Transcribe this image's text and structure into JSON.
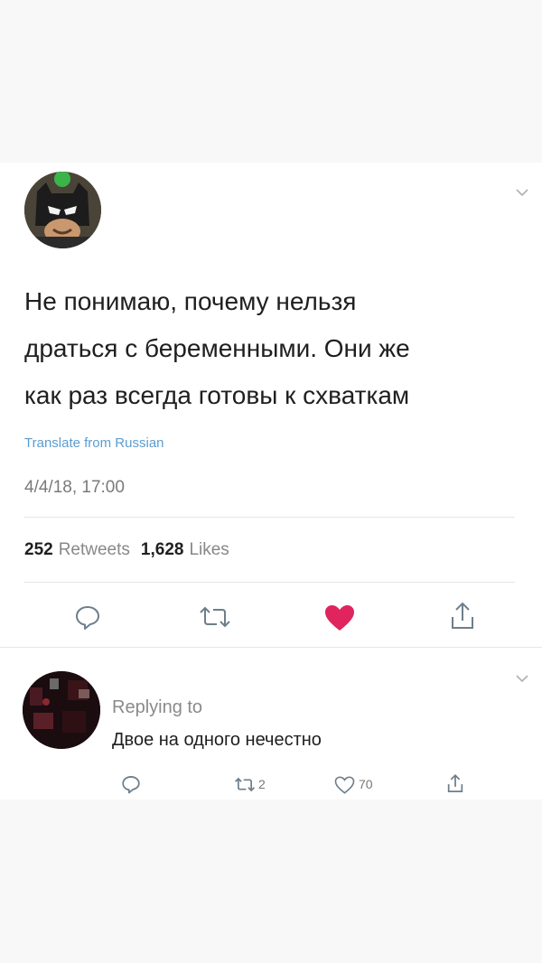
{
  "tweet": {
    "text": "Не понимаю, почему нельзя\nдраться с беременными. Они же\nкак раз всегда готовы к схваткам",
    "translate_label": "Translate from Russian",
    "timestamp": "4/4/18, 17:00",
    "retweets_count": "252",
    "retweets_label": "Retweets",
    "likes_count": "1,628",
    "likes_label": "Likes",
    "liked": true
  },
  "reply": {
    "replying_label": "Replying to",
    "text": "Двое на одного нечестно",
    "retweets_count": "2",
    "likes_count": "70"
  },
  "icons": {
    "reply": "reply-icon",
    "retweet": "retweet-icon",
    "like": "heart-icon",
    "share": "share-icon",
    "chevron": "chevron-down-icon"
  },
  "colors": {
    "like_active": "#e0245e",
    "link": "#5b9dd1",
    "icon_gray": "#8899a6"
  }
}
